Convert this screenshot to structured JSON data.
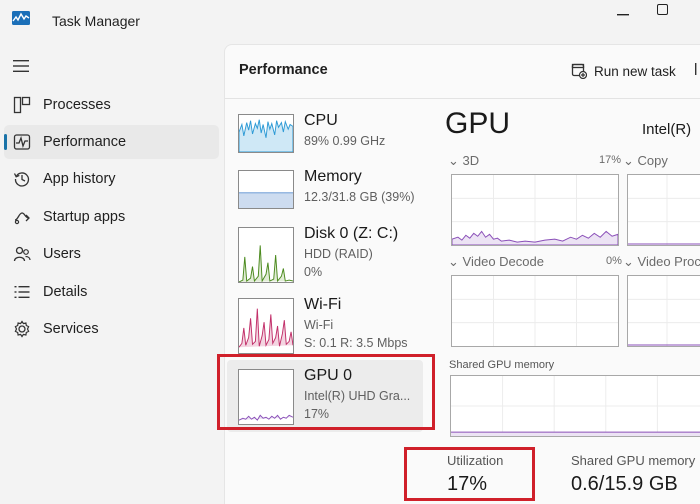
{
  "app": {
    "title": "Task Manager",
    "logo_icon": "task-manager-logo-icon"
  },
  "sidebar": {
    "items": [
      {
        "label": "Processes",
        "icon": "processes-icon"
      },
      {
        "label": "Performance",
        "icon": "performance-icon",
        "active": true
      },
      {
        "label": "App history",
        "icon": "app-history-icon"
      },
      {
        "label": "Startup apps",
        "icon": "startup-apps-icon"
      },
      {
        "label": "Users",
        "icon": "users-icon"
      },
      {
        "label": "Details",
        "icon": "details-icon"
      },
      {
        "label": "Services",
        "icon": "services-icon"
      }
    ]
  },
  "header": {
    "title": "Performance",
    "run_new_task": "Run new task"
  },
  "resources": [
    {
      "name": "CPU",
      "line1": "89% 0.99 GHz",
      "line2": "",
      "color": "#2f9bd6"
    },
    {
      "name": "Memory",
      "line1": "12.3/31.8 GB (39%)",
      "line2": "",
      "color": "#5a8fd0"
    },
    {
      "name": "Disk 0 (Z: C:)",
      "line1": "HDD (RAID)",
      "line2": "0%",
      "color": "#4b8a1e"
    },
    {
      "name": "Wi-Fi",
      "line1": "Wi-Fi",
      "line2": "S: 0.1  R: 3.5 Mbps",
      "color": "#c2306a"
    },
    {
      "name": "GPU 0",
      "line1": "Intel(R) UHD Gra...",
      "line2": "17%",
      "color": "#8a4fb8",
      "selected": true
    }
  ],
  "gpu": {
    "heading": "GPU",
    "model": "Intel(R)",
    "engines": [
      {
        "label": "3D",
        "percent": "17%"
      },
      {
        "label": "Copy",
        "percent": ""
      },
      {
        "label": "Video Decode",
        "percent": "0%"
      },
      {
        "label": "Video Proc",
        "percent": ""
      }
    ],
    "shared_memory_graph_label": "Shared GPU memory",
    "stats": {
      "utilization_label": "Utilization",
      "utilization_value": "17%",
      "shared_memory_label": "Shared GPU memory",
      "shared_memory_value": "0.6/15.9 GB"
    }
  },
  "colors": {
    "gpu_line": "#8a4fb8",
    "gpu_fill": "#ece3f4",
    "annotation": "#d0202a",
    "accent": "#1a73a8"
  }
}
